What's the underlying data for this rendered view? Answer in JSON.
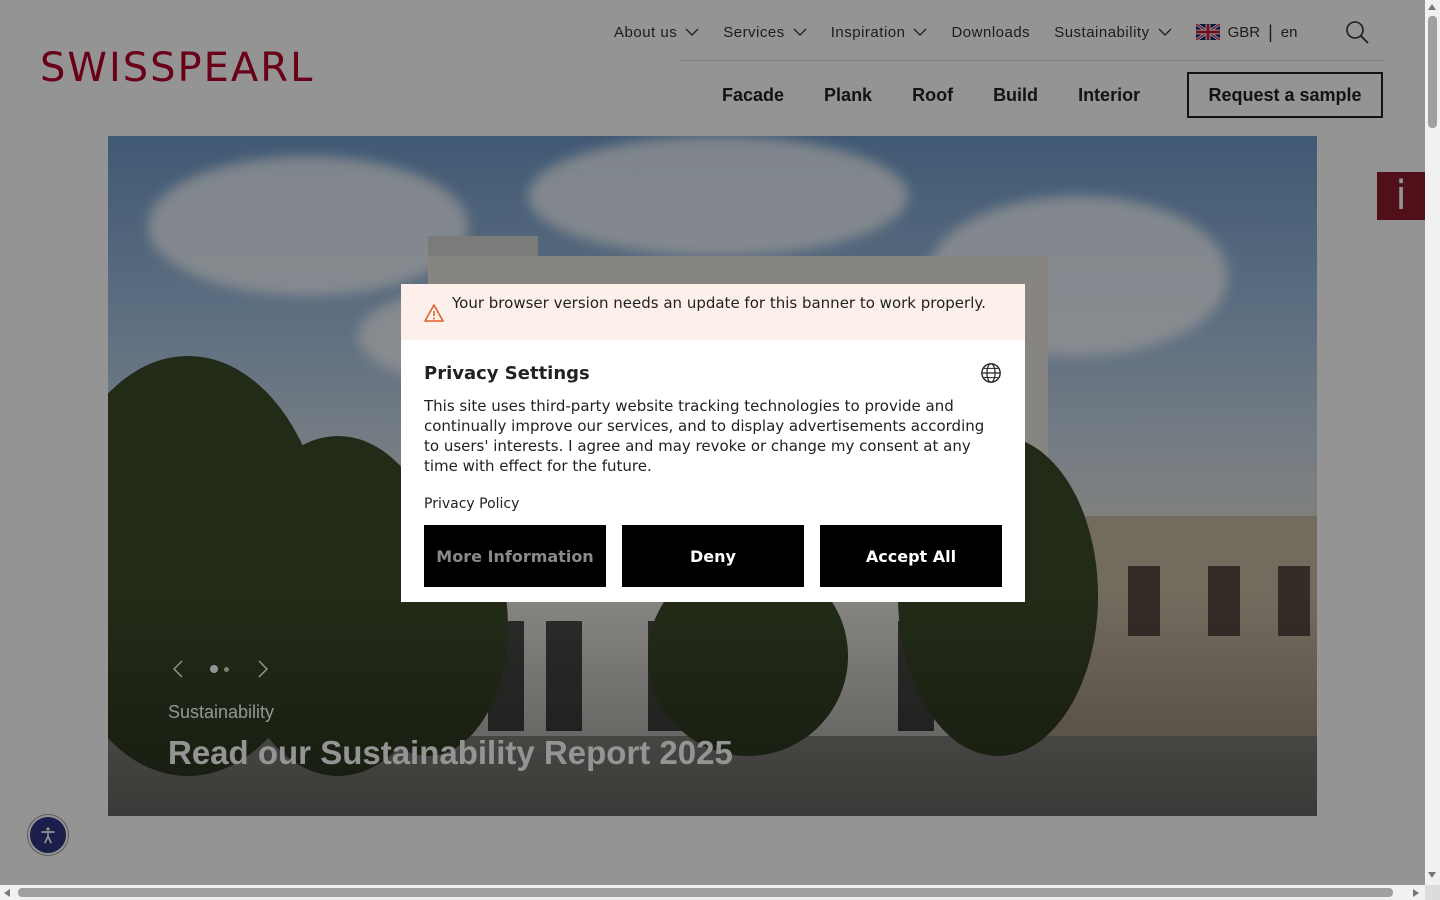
{
  "header": {
    "logo_text": "SWISSPEARL",
    "top_nav": [
      {
        "label": "About us",
        "has_dropdown": true
      },
      {
        "label": "Services",
        "has_dropdown": true
      },
      {
        "label": "Inspiration",
        "has_dropdown": true
      },
      {
        "label": "Downloads",
        "has_dropdown": false
      },
      {
        "label": "Sustainability",
        "has_dropdown": true
      }
    ],
    "region": {
      "country": "GBR",
      "separator": "|",
      "language": "en",
      "flag_icon": "uk-flag-icon"
    },
    "search_icon": "search-icon",
    "main_nav": [
      "Facade",
      "Plank",
      "Roof",
      "Build",
      "Interior"
    ],
    "cta_label": "Request a sample"
  },
  "hero": {
    "category": "Sustainability",
    "title": "Read our Sustainability Report 2025",
    "slide_count": 2,
    "active_slide": 1
  },
  "info_tab": {
    "glyph": "i"
  },
  "consent": {
    "warning": "Your browser version needs an update for this banner to work properly.",
    "title": "Privacy Settings",
    "description": "This site uses third-party website tracking technologies to provide and continually improve our services, and to display advertisements according to users' interests. I agree and may revoke or change my consent at any time with effect for the future.",
    "policy_link": "Privacy Policy",
    "buttons": {
      "more_info": "More Information",
      "deny": "Deny",
      "accept": "Accept All"
    }
  },
  "colors": {
    "brand": "#b5002a",
    "info_tab": "#8c1a2b",
    "accessibility_button": "#2b3582",
    "warning_bg": "#fdf0ea",
    "warning_icon": "#e0602a"
  }
}
